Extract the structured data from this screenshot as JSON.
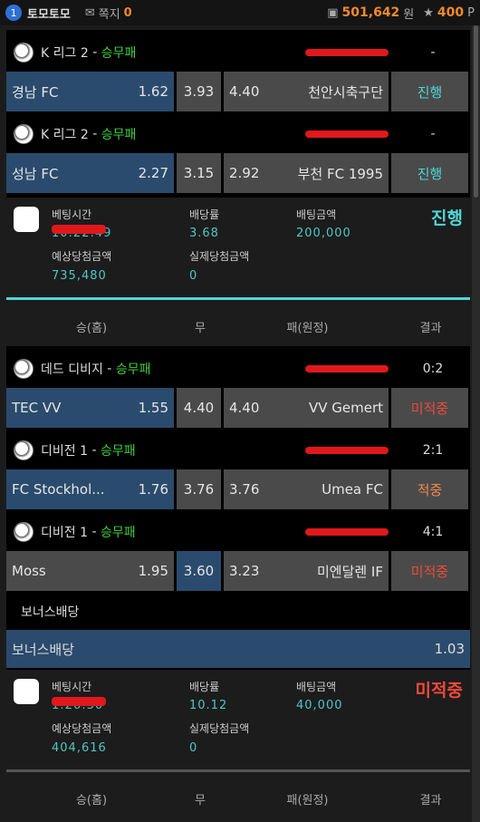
{
  "header": {
    "badge": "1",
    "site": "토모토모",
    "note_label": "쪽지",
    "note_count": "0",
    "balance": "501,642",
    "currency": "원",
    "points": "400",
    "points_unit": "P"
  },
  "columns": {
    "home": "승(홈)",
    "draw": "무",
    "away": "패(원정)",
    "result": "결과"
  },
  "slips": [
    {
      "matches": [
        {
          "league": "K 리그 2",
          "type": "승무패",
          "result": "-",
          "home": "경남 FC",
          "home_odds": "1.62",
          "draw_odds": "3.93",
          "away_odds": "4.40",
          "away": "천안시축구단",
          "status": "진행",
          "selected": "home"
        },
        {
          "league": "K 리그 2",
          "type": "승무패",
          "result": "-",
          "home": "성남 FC",
          "home_odds": "2.27",
          "draw_odds": "3.15",
          "away_odds": "2.92",
          "away": "부천 FC 1995",
          "status": "진행",
          "selected": "home"
        }
      ],
      "labels": {
        "bet_time": "베팅시간",
        "odds": "배당률",
        "amount": "배팅금액",
        "expected": "예상당첨금액",
        "actual": "실제당첨금액"
      },
      "bet_time": "10:22:49",
      "odds": "3.68",
      "amount": "200,000",
      "expected": "735,480",
      "actual": "0",
      "status": "진행"
    },
    {
      "matches": [
        {
          "league": "데드 디비지",
          "type": "승무패",
          "result": "0:2",
          "home": "TEC VV",
          "home_odds": "1.55",
          "draw_odds": "4.40",
          "away_odds": "4.40",
          "away": "VV Gemert",
          "status": "미적중",
          "selected": "home"
        },
        {
          "league": "디비전 1",
          "type": "승무패",
          "result": "2:1",
          "home": "FC Stockhol...",
          "home_odds": "1.76",
          "draw_odds": "3.76",
          "away_odds": "3.76",
          "away": "Umea FC",
          "status": "적중",
          "selected": "home"
        },
        {
          "league": "디비전 1",
          "type": "승무패",
          "result": "4:1",
          "home": "Moss",
          "home_odds": "1.95",
          "draw_odds": "3.60",
          "away_odds": "3.23",
          "away": "미엔달렌 IF",
          "status": "미적중",
          "selected": "draw"
        }
      ],
      "bonus_title": "보너스배당",
      "bonus_label": "보너스배당",
      "bonus_odds": "1.03",
      "labels": {
        "bet_time": "베팅시간",
        "odds": "배당률",
        "amount": "배팅금액",
        "expected": "예상당첨금액",
        "actual": "실제당첨금액"
      },
      "bet_time": "1:26:30",
      "odds": "10.12",
      "amount": "40,000",
      "expected": "404,616",
      "actual": "0",
      "status": "미적중"
    }
  ],
  "colors": {
    "selected": "#2a4b6d",
    "win": "#f28a4a",
    "lose": "#f04a3a",
    "progress": "#4fd6d6",
    "league_type": "#3ecf3e"
  }
}
